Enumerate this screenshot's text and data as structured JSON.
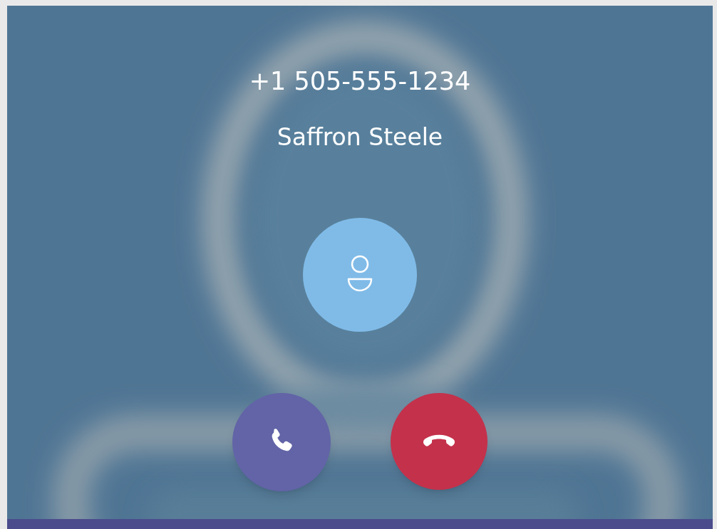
{
  "caller": {
    "number": "+1 505-555-1234",
    "name": "Saffron Steele"
  },
  "actions": [
    {
      "kind": "accept"
    },
    {
      "kind": "decline"
    }
  ]
}
